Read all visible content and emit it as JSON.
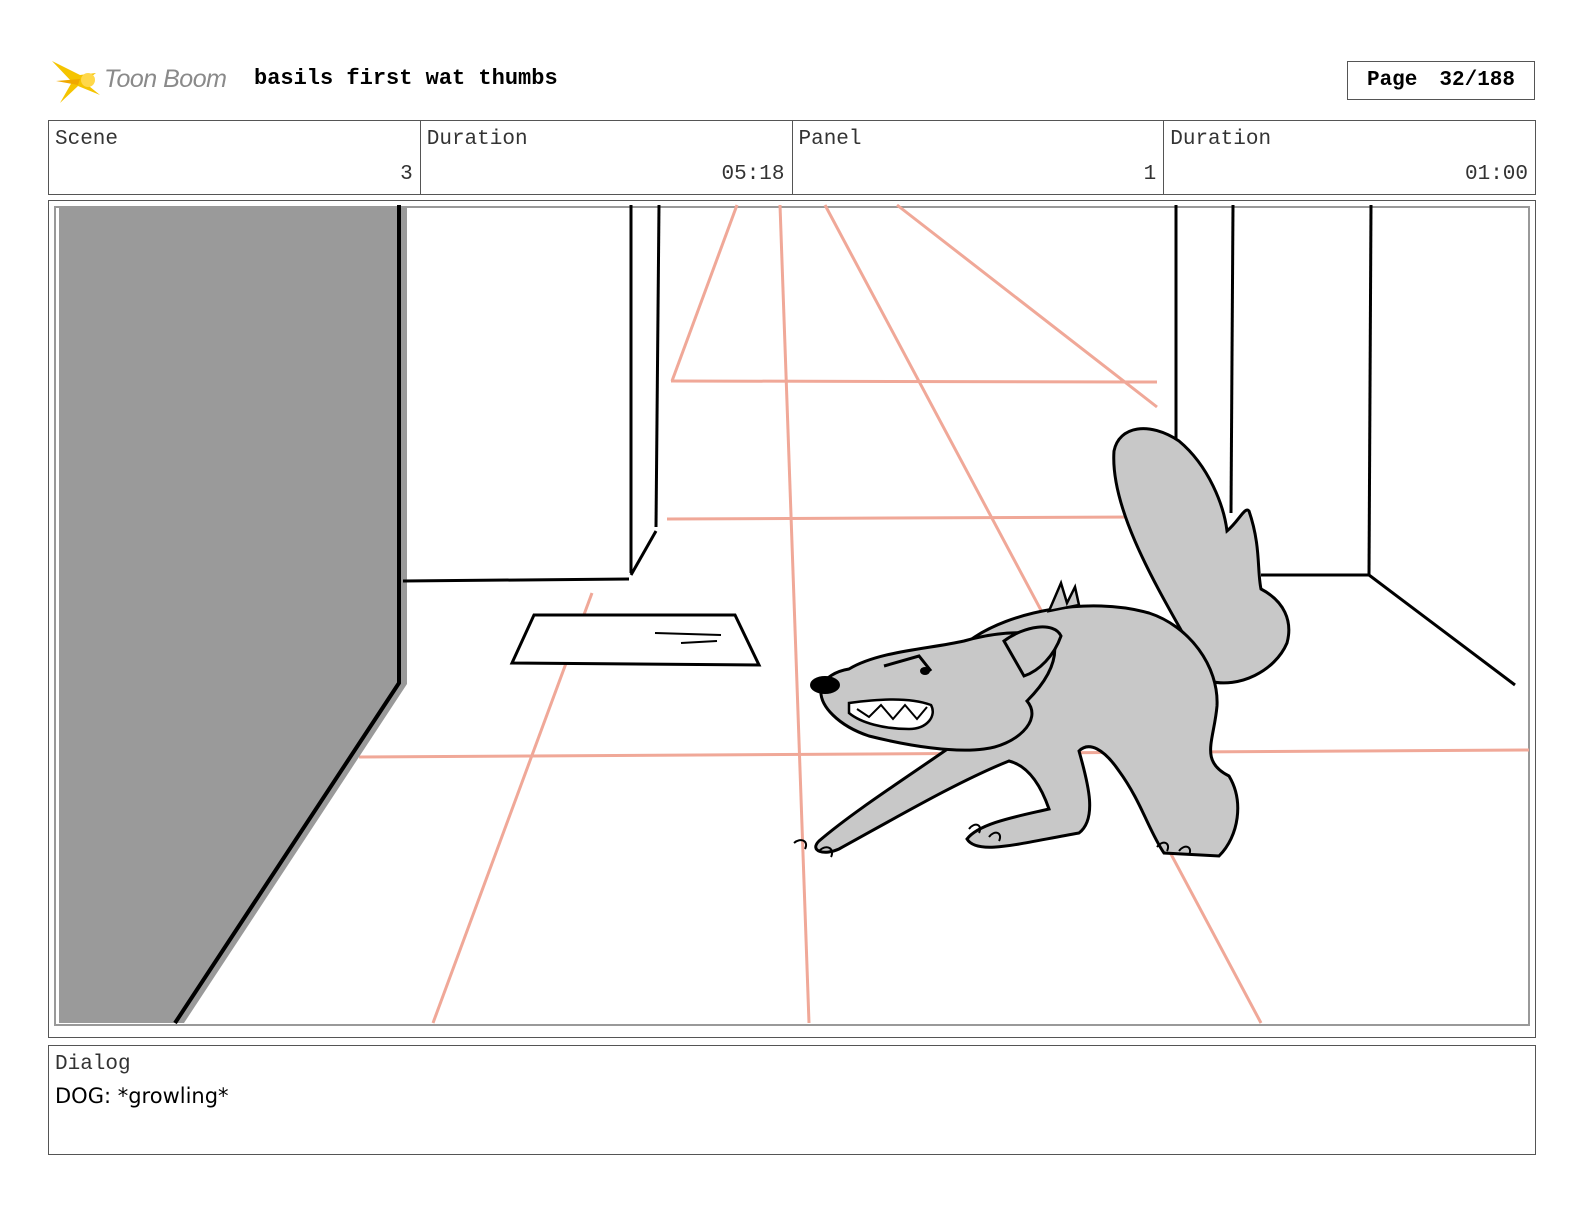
{
  "header": {
    "logo_text": "Toon Boom",
    "title": "basils first wat thumbs",
    "page_label": "Page",
    "page_number": "32/188"
  },
  "info": {
    "scene_label": "Scene",
    "scene_value": "3",
    "scene_duration_label": "Duration",
    "scene_duration_value": "05:18",
    "panel_label": "Panel",
    "panel_value": "1",
    "panel_duration_label": "Duration",
    "panel_duration_value": "01:00"
  },
  "dialog": {
    "label": "Dialog",
    "text": "DOG: *growling*"
  },
  "colors": {
    "logo_accent": "#f5c400",
    "perspective_lines": "#f0a898",
    "wall_fill": "#9a9a9a",
    "dog_fill": "#c8c8c8"
  }
}
